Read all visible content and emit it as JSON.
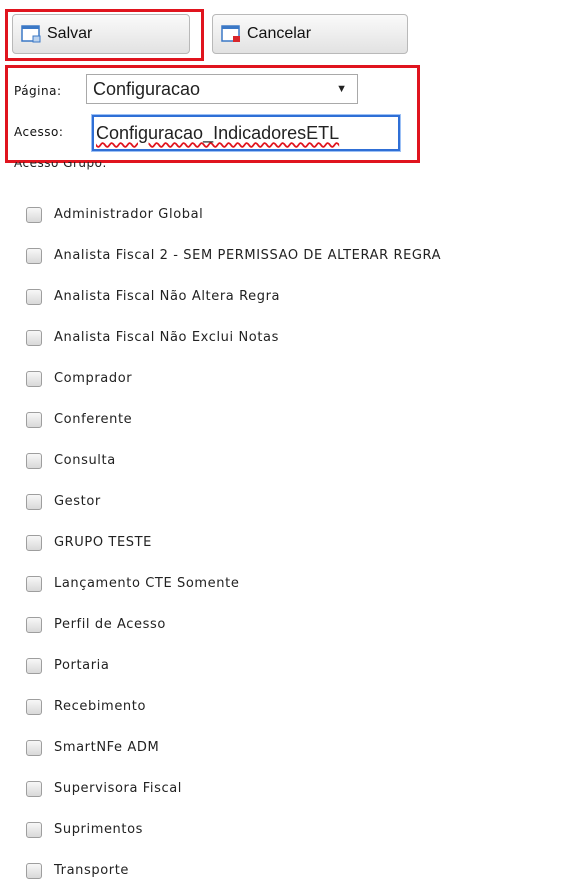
{
  "toolbar": {
    "save_label": "Salvar",
    "cancel_label": "Cancelar",
    "save_icon": "save-window-icon",
    "cancel_icon": "cancel-window-icon"
  },
  "form": {
    "pagina_label": "Página:",
    "pagina_value": "Configuracao",
    "acesso_label": "Acesso:",
    "acesso_value": "Configuracao_IndicadoresETL",
    "grupo_heading": "Acesso Grupo:"
  },
  "groups": [
    {
      "label": "Administrador Global",
      "checked": false
    },
    {
      "label": "Analista Fiscal 2 - SEM PERMISSAO DE ALTERAR REGRA",
      "checked": false
    },
    {
      "label": "Analista Fiscal Não Altera Regra",
      "checked": false
    },
    {
      "label": "Analista Fiscal Não Exclui Notas",
      "checked": false
    },
    {
      "label": "Comprador",
      "checked": false
    },
    {
      "label": "Conferente",
      "checked": false
    },
    {
      "label": "Consulta",
      "checked": false
    },
    {
      "label": "Gestor",
      "checked": false
    },
    {
      "label": "GRUPO TESTE",
      "checked": false
    },
    {
      "label": "Lançamento CTE Somente",
      "checked": false
    },
    {
      "label": "Perfil de Acesso",
      "checked": false
    },
    {
      "label": "Portaria",
      "checked": false
    },
    {
      "label": "Recebimento",
      "checked": false
    },
    {
      "label": "SmartNFe ADM",
      "checked": false
    },
    {
      "label": "Supervisora Fiscal",
      "checked": false
    },
    {
      "label": "Suprimentos",
      "checked": false
    },
    {
      "label": "Transporte",
      "checked": false
    }
  ],
  "colors": {
    "highlight": "#e0141e",
    "focus": "#2f6fd6",
    "icon_blue": "#3b78c6",
    "icon_red": "#d8262b"
  }
}
